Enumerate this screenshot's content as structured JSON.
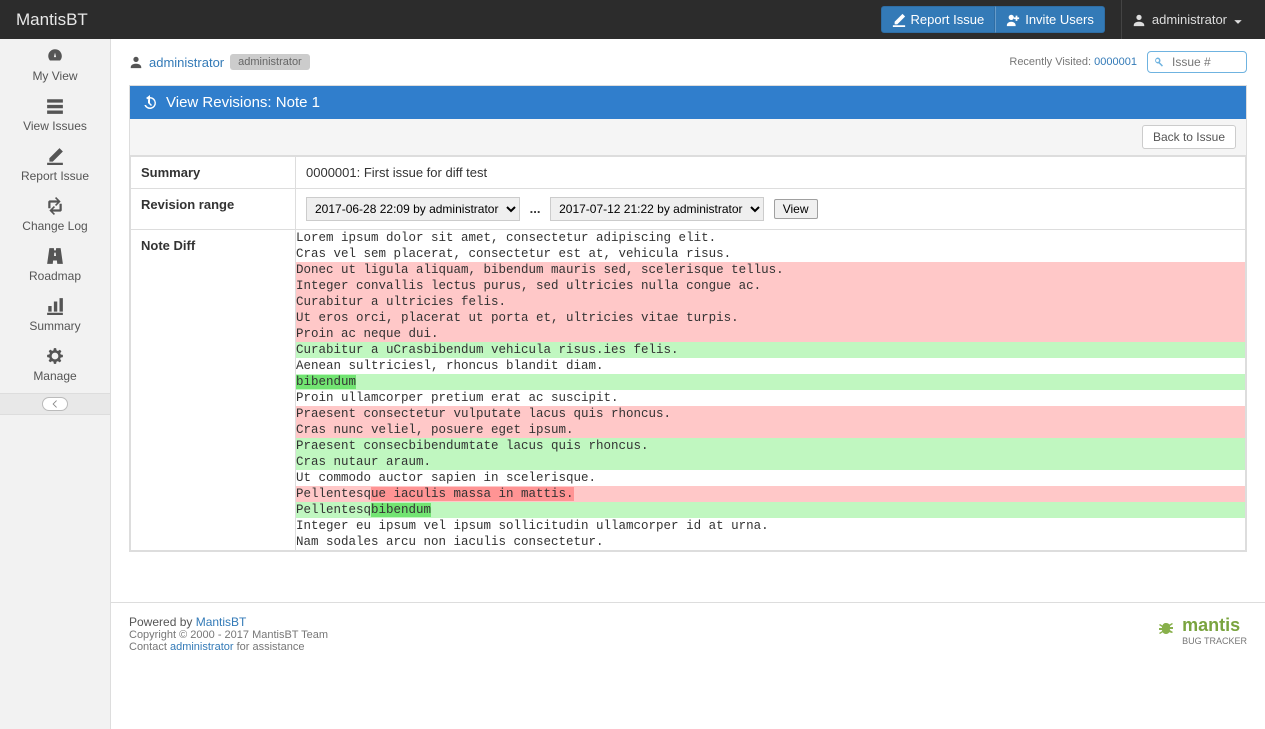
{
  "navbar": {
    "brand": "MantisBT",
    "report_btn": "Report Issue",
    "invite_btn": "Invite Users",
    "user": "administrator"
  },
  "sidebar": {
    "items": [
      {
        "label": "My View"
      },
      {
        "label": "View Issues"
      },
      {
        "label": "Report Issue"
      },
      {
        "label": "Change Log"
      },
      {
        "label": "Roadmap"
      },
      {
        "label": "Summary"
      },
      {
        "label": "Manage"
      }
    ]
  },
  "breadcrumb": {
    "user": "administrator",
    "role": "administrator",
    "recently_label": "Recently Visited:",
    "recently_link": "0000001",
    "search_placeholder": "Issue #"
  },
  "panel": {
    "title": "View Revisions: Note 1",
    "back_btn": "Back to Issue",
    "rows": {
      "summary_label": "Summary",
      "summary_value": "0000001: First issue for diff test",
      "range_label": "Revision range",
      "range_from": "2017-06-28 22:09 by administrator",
      "range_to": "2017-07-12 21:22 by administrator",
      "view_btn": "View",
      "diff_label": "Note Diff"
    }
  },
  "diff": [
    {
      "type": "ctx",
      "text": "Lorem ipsum dolor sit amet, consectetur adipiscing elit."
    },
    {
      "type": "rem",
      "text": ""
    },
    {
      "type": "ctx",
      "text": "Cras vel sem placerat, consectetur est at, vehicula risus."
    },
    {
      "type": "rem",
      "text": "Donec ut ligula aliquam, bibendum mauris sed, scelerisque tellus."
    },
    {
      "type": "rem",
      "text": "Integer convallis lectus purus, sed ultricies nulla congue ac."
    },
    {
      "type": "rem",
      "text": "Curabitur a ultricies felis."
    },
    {
      "type": "rem",
      "text": "Ut eros orci, placerat ut porta et, ultricies vitae turpis."
    },
    {
      "type": "rem",
      "text": "Proin ac neque dui."
    },
    {
      "type": "add",
      "text": "Curabitur a uCrasbibendum vehicula risus.ies felis."
    },
    {
      "type": "ctx",
      "text": "Aenean sultriciesl, rhoncus blandit diam."
    },
    {
      "type": "add_inline",
      "prefix": "",
      "hl": "bibendum",
      "suffix": ""
    },
    {
      "type": "ctx",
      "text": "Proin ullamcorper pretium erat ac suscipit."
    },
    {
      "type": "rem",
      "text": "Praesent consectetur vulputate lacus quis rhoncus."
    },
    {
      "type": "rem",
      "text": "Cras nunc veliel, posuere eget ipsum."
    },
    {
      "type": "add",
      "text": "Praesent consecbibendumtate lacus quis rhoncus."
    },
    {
      "type": "add",
      "text": "Cras nutaur araum."
    },
    {
      "type": "ctx",
      "text": "Ut commodo auctor sapien in scelerisque."
    },
    {
      "type": "rem_inline",
      "prefix": "Pellentesq",
      "hl": "ue iaculis massa in mattis.",
      "suffix": ""
    },
    {
      "type": "add_inline",
      "prefix": "Pellentesq",
      "hl": "bibendum",
      "suffix": ""
    },
    {
      "type": "ctx",
      "text": "Integer eu ipsum vel ipsum sollicitudin ullamcorper id at urna."
    },
    {
      "type": "ctx",
      "text": "Nam sodales arcu non iaculis consectetur."
    },
    {
      "type": "add",
      "text": ""
    },
    {
      "type": "add",
      "text": ""
    }
  ],
  "footer": {
    "powered": "Powered by ",
    "powered_link": "MantisBT",
    "copyright": "Copyright © 2000 - 2017 MantisBT Team",
    "contact_pre": "Contact ",
    "contact_link": "administrator",
    "contact_post": " for assistance",
    "logo_text": "mantis",
    "logo_sub": "BUG TRACKER"
  }
}
